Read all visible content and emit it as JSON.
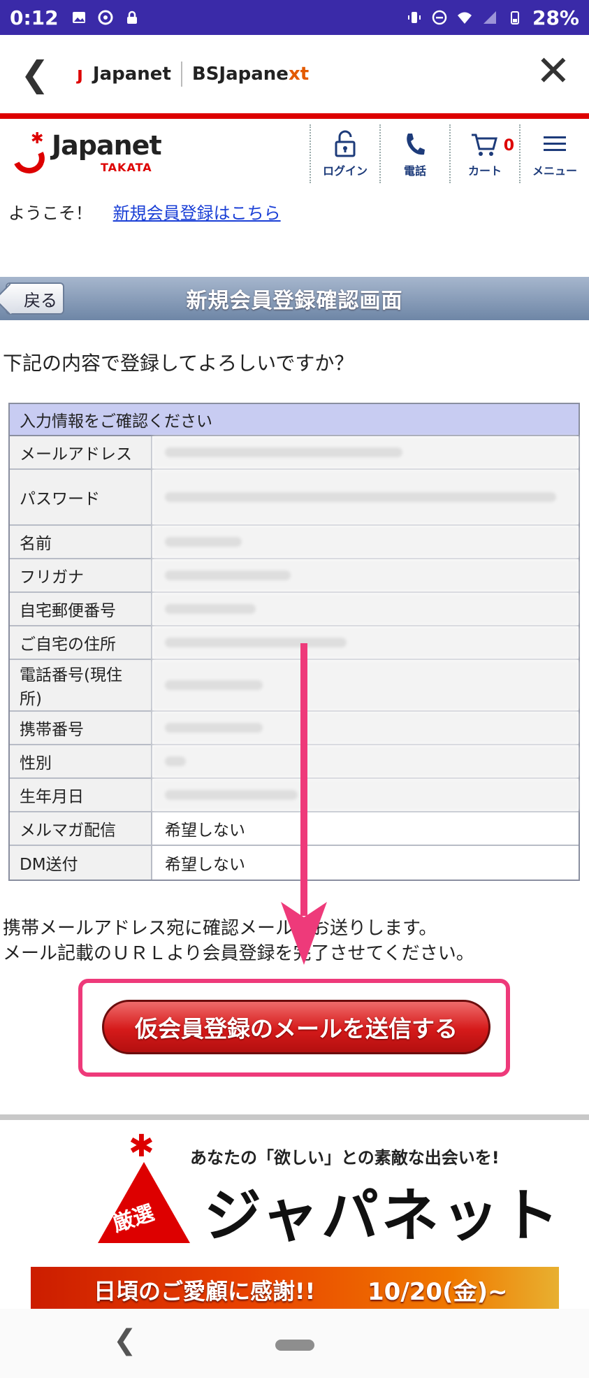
{
  "status_bar": {
    "time": "0:12",
    "battery": "28%"
  },
  "browser": {
    "logo_japanet": "Japanet",
    "logo_bs": "BSJapane",
    "logo_bs_suffix": "xt"
  },
  "site": {
    "logo_main": "Japanet",
    "logo_sub": "TAKATA",
    "nav": [
      {
        "label": "ログイン",
        "icon": "lock-icon"
      },
      {
        "label": "電話",
        "icon": "phone-icon"
      },
      {
        "label": "カート",
        "icon": "cart-icon",
        "count": "0"
      },
      {
        "label": "メニュー",
        "icon": "menu-icon"
      }
    ],
    "welcome_text": "ようこそ！",
    "register_link": "新規会員登録はこちら"
  },
  "titlebar": {
    "back_label": "戻る",
    "title": "新規会員登録確認画面"
  },
  "question": "下記の内容で登録してよろしいですか？",
  "table": {
    "header": "入力情報をご確認ください",
    "rows": [
      {
        "label": "メールアドレス",
        "value": ""
      },
      {
        "label": "パスワード",
        "value": ""
      },
      {
        "label": "名前",
        "value": ""
      },
      {
        "label": "フリガナ",
        "value": ""
      },
      {
        "label": "自宅郵便番号",
        "value": ""
      },
      {
        "label": "ご自宅の住所",
        "value": ""
      },
      {
        "label": "電話番号(現住所)",
        "value": ""
      },
      {
        "label": "携帯番号",
        "value": ""
      },
      {
        "label": "性別",
        "value": ""
      },
      {
        "label": "生年月日",
        "value": ""
      },
      {
        "label": "メルマガ配信",
        "value": "希望しない"
      },
      {
        "label": "DM送付",
        "value": "希望しない"
      }
    ]
  },
  "note_line1": "携帯メールアドレス宛に確認メールをお送りします。",
  "note_line2": "メール記載のＵＲＬより会員登録を完了させてください。",
  "send_button": "仮会員登録のメールを送信する",
  "banner": {
    "tagline": "あなたの「欲しい」との素敵な出会いを!",
    "name": "ジャパネット",
    "badge": "厳選",
    "promo_text": "日頃のご愛顧に感謝!!",
    "promo_date": "10/20(金)~"
  },
  "colors": {
    "status_bar": "#3a2aa8",
    "accent_red": "#d00000",
    "highlight_pink": "#ee3a7a",
    "link_blue": "#1a3fd6"
  }
}
